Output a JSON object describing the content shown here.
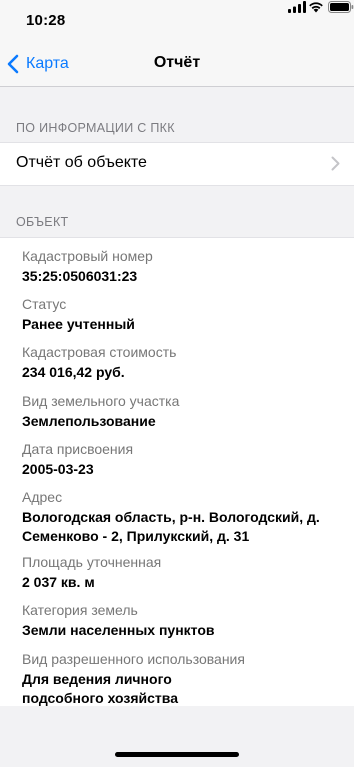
{
  "status_bar": {
    "time": "10:28",
    "icons": [
      "signal-icon",
      "wifi-icon",
      "battery-icon"
    ]
  },
  "nav": {
    "back_label": "Карта",
    "title": "Отчёт",
    "accent_color": "#0a7aff"
  },
  "sections": {
    "pkk_header": "ПО ИНФОРМАЦИИ С ПКК",
    "report_row_label": "Отчёт об объекте",
    "object_header": "ОБЪЕКТ"
  },
  "object": {
    "fields": [
      {
        "label": "Кадастровый номер",
        "value": "35:25:0506031:23"
      },
      {
        "label": "Статус",
        "value": "Ранее учтенный"
      },
      {
        "label": "Кадастровая стоимость",
        "value": "234 016,42 руб."
      },
      {
        "label": "Вид земельного участка",
        "value": "Землепользование"
      },
      {
        "label": "Дата присвоения",
        "value": "2005-03-23"
      },
      {
        "label": "Адрес",
        "value_lines": [
          "Вологодская область, р-н. Вологодский, д.",
          "Семенково - 2, Прилукский, д. 31"
        ]
      },
      {
        "label": "Площадь уточненная",
        "value": "2 037 кв. м"
      },
      {
        "label": "Категория земель",
        "value": "Земли населенных пунктов"
      },
      {
        "label": "Вид разрешенного использования",
        "value_lines": [
          "Для ведения личного",
          "подсобного хозяйства"
        ]
      }
    ]
  }
}
